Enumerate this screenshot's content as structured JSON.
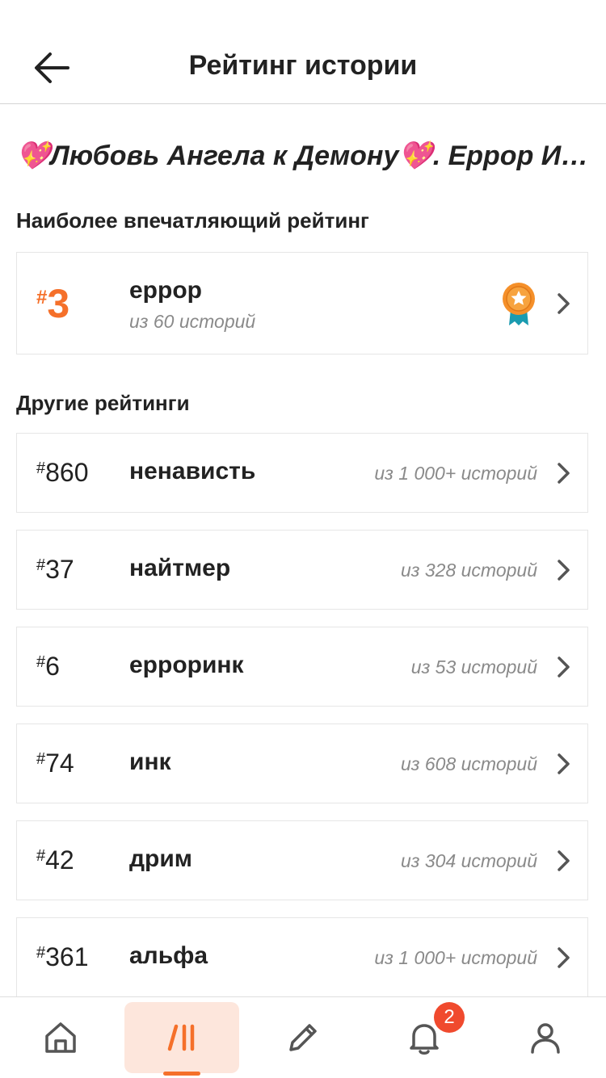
{
  "header": {
    "title": "Рейтинг истории"
  },
  "story": {
    "title": "💖Любовь Ангела к Демону💖.  Еррор Инк"
  },
  "sections": {
    "top_label": "Наиболее впечатляющий рейтинг",
    "others_label": "Другие рейтинги"
  },
  "top_ranking": {
    "hash": "#",
    "rank": "3",
    "tag": "еррор",
    "count": "из 60 историй",
    "medal_icon": "medal-star-icon"
  },
  "rankings": [
    {
      "hash": "#",
      "rank": "860",
      "tag": "ненависть",
      "count": "из 1 000+ историй"
    },
    {
      "hash": "#",
      "rank": "37",
      "tag": "найтмер",
      "count": "из 328 историй"
    },
    {
      "hash": "#",
      "rank": "6",
      "tag": "ерроринк",
      "count": "из 53 историй"
    },
    {
      "hash": "#",
      "rank": "74",
      "tag": "инк",
      "count": "из 608 историй"
    },
    {
      "hash": "#",
      "rank": "42",
      "tag": "дрим",
      "count": "из 304 историй"
    },
    {
      "hash": "#",
      "rank": "361",
      "tag": "альфа",
      "count": "из 1 000+ историй"
    }
  ],
  "nav": {
    "items": [
      "home-icon",
      "library-icon",
      "write-icon",
      "bell-icon",
      "profile-icon"
    ],
    "active": "library-icon",
    "notification_badge": "2"
  },
  "colors": {
    "accent": "#f5702a",
    "active_tab_bg": "#fde6dc",
    "badge": "#f04a2e",
    "medal_ribbon": "#1a9bb0"
  }
}
